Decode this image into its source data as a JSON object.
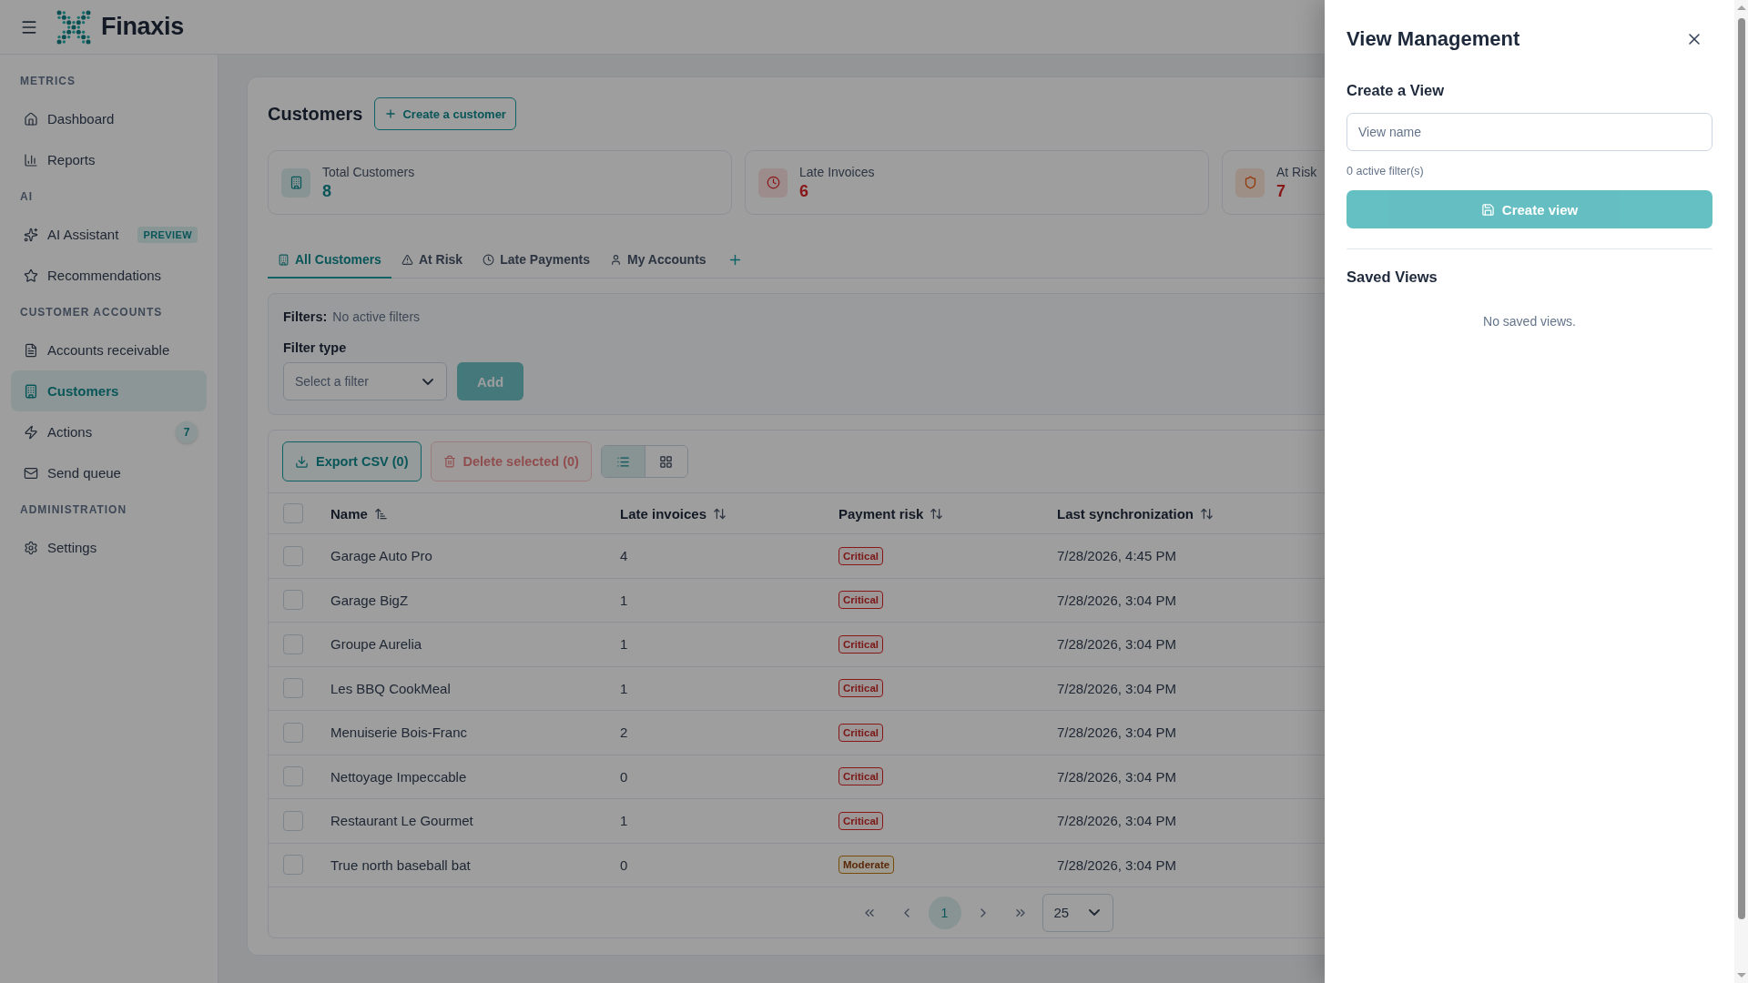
{
  "header": {
    "brand": "Finaxis"
  },
  "sidebar": {
    "sections": [
      {
        "title": "METRICS",
        "items": [
          {
            "label": "Dashboard",
            "selected": false
          },
          {
            "label": "Reports",
            "selected": false
          }
        ]
      },
      {
        "title": "AI",
        "items": [
          {
            "label": "AI Assistant",
            "tag": "PREVIEW",
            "selected": false
          },
          {
            "label": "Recommendations",
            "selected": false
          }
        ]
      },
      {
        "title": "CUSTOMER ACCOUNTS",
        "items": [
          {
            "label": "Accounts receivable",
            "selected": false
          },
          {
            "label": "Customers",
            "selected": true
          },
          {
            "label": "Actions",
            "count": "7",
            "selected": false
          },
          {
            "label": "Send queue",
            "selected": false
          }
        ]
      },
      {
        "title": "ADMINISTRATION",
        "items": [
          {
            "label": "Settings",
            "selected": false
          }
        ]
      }
    ]
  },
  "page": {
    "title": "Customers",
    "create_button": "Create a customer"
  },
  "stats": [
    {
      "kind": "total",
      "label": "Total Customers",
      "value": "8"
    },
    {
      "kind": "late",
      "label": "Late Invoices",
      "value": "6"
    },
    {
      "kind": "risk",
      "label": "At Risk",
      "value": "7"
    }
  ],
  "tabs": [
    {
      "label": "All Customers",
      "selected": true
    },
    {
      "label": "At Risk",
      "selected": false
    },
    {
      "label": "Late Payments",
      "selected": false
    },
    {
      "label": "My Accounts",
      "selected": false
    }
  ],
  "filters": {
    "label": "Filters:",
    "summary": "No active filters",
    "type_label": "Filter type",
    "type_select": {
      "placeholder": "Select a filter"
    },
    "add_button": {
      "label": "Add",
      "disabled": true
    }
  },
  "toolbar": {
    "export_button": "Export CSV (0)",
    "delete_button": {
      "label": "Delete selected (0)",
      "disabled": true
    },
    "views": [
      {
        "kind": "list",
        "selected": true
      },
      {
        "kind": "grid",
        "selected": false
      }
    ]
  },
  "table": {
    "select_all": {
      "checked": false
    },
    "columns": [
      {
        "label": "Name",
        "sorted": true
      },
      {
        "label": "Late invoices",
        "sorted": false
      },
      {
        "label": "Payment risk",
        "sorted": false
      },
      {
        "label": "Last synchronization",
        "sorted": false
      }
    ],
    "rows": [
      {
        "checked": false,
        "name": "Garage Auto Pro",
        "late_invoices": "4",
        "risk": {
          "label": "Critical",
          "kind": "critical"
        },
        "last_sync": "7/28/2026, 4:45 PM"
      },
      {
        "checked": false,
        "name": "Garage BigZ",
        "late_invoices": "1",
        "risk": {
          "label": "Critical",
          "kind": "critical"
        },
        "last_sync": "7/28/2026, 3:04 PM"
      },
      {
        "checked": false,
        "name": "Groupe Aurelia",
        "late_invoices": "1",
        "risk": {
          "label": "Critical",
          "kind": "critical"
        },
        "last_sync": "7/28/2026, 3:04 PM"
      },
      {
        "checked": false,
        "name": "Les BBQ CookMeal",
        "late_invoices": "1",
        "risk": {
          "label": "Critical",
          "kind": "critical"
        },
        "last_sync": "7/28/2026, 3:04 PM"
      },
      {
        "checked": false,
        "name": "Menuiserie Bois-Franc",
        "late_invoices": "2",
        "risk": {
          "label": "Critical",
          "kind": "critical"
        },
        "last_sync": "7/28/2026, 3:04 PM"
      },
      {
        "checked": false,
        "name": "Nettoyage Impeccable",
        "late_invoices": "0",
        "risk": {
          "label": "Critical",
          "kind": "critical"
        },
        "last_sync": "7/28/2026, 3:04 PM"
      },
      {
        "checked": false,
        "name": "Restaurant Le Gourmet",
        "late_invoices": "1",
        "risk": {
          "label": "Critical",
          "kind": "critical"
        },
        "last_sync": "7/28/2026, 3:04 PM"
      },
      {
        "checked": false,
        "name": "True north baseball bat",
        "late_invoices": "0",
        "risk": {
          "label": "Moderate",
          "kind": "moderate"
        },
        "last_sync": "7/28/2026, 3:04 PM"
      }
    ]
  },
  "pagination": {
    "pages": [
      {
        "label": "1",
        "selected": true
      }
    ],
    "page_size": "25"
  },
  "view_panel": {
    "title": "View Management",
    "create_heading": "Create a View",
    "name_field": {
      "placeholder": "View name"
    },
    "filter_count": "0 active filter(s)",
    "create_button": {
      "label": "Create view",
      "disabled": true
    },
    "saved_heading": "Saved Views",
    "empty_message": "No saved views."
  }
}
